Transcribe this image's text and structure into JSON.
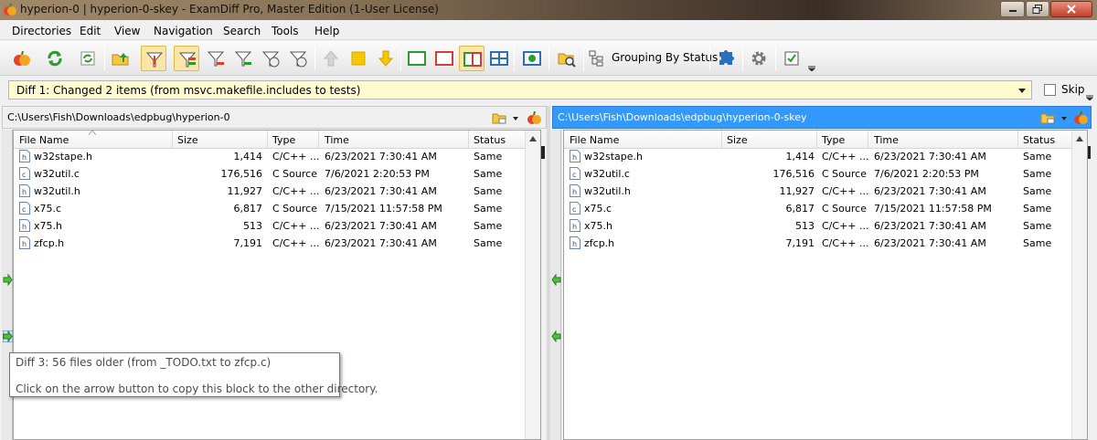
{
  "window": {
    "title": "hyperion-0  |  hyperion-0-skey - ExamDiff Pro, Master Edition (1-User License)"
  },
  "menu": [
    "Directories",
    "Edit",
    "View",
    "Navigation",
    "Search",
    "Tools",
    "Help"
  ],
  "toolbar": {
    "grouping_label": "Grouping By Status"
  },
  "diff_bar": {
    "current_diff": "Diff 1: Changed 2 items (from msvc.makefile.includes to tests)",
    "skip_label": "Skip",
    "skip_checked": false
  },
  "columns": [
    "File Name",
    "Size",
    "Type",
    "Time",
    "Status"
  ],
  "left": {
    "path": "C:\\Users\\Fish\\Downloads\\edpbug\\hyperion-0",
    "rows": [
      {
        "name": "w32stape.h",
        "size": "1,414",
        "type": "C/C++ ...",
        "time": "6/23/2021 7:30:41 AM",
        "status": "Same",
        "icon": "h"
      },
      {
        "name": "w32util.c",
        "size": "176,516",
        "type": "C Source",
        "time": "7/6/2021 2:20:53 PM",
        "status": "Same",
        "icon": "c"
      },
      {
        "name": "w32util.h",
        "size": "11,927",
        "type": "C/C++ ...",
        "time": "6/23/2021 7:30:41 AM",
        "status": "Same",
        "icon": "h"
      },
      {
        "name": "x75.c",
        "size": "6,817",
        "type": "C Source",
        "time": "7/15/2021 11:57:58 PM",
        "status": "Same",
        "icon": "c"
      },
      {
        "name": "x75.h",
        "size": "513",
        "type": "C/C++ ...",
        "time": "6/23/2021 7:30:41 AM",
        "status": "Same",
        "icon": "h"
      },
      {
        "name": "zfcp.h",
        "size": "7,191",
        "type": "C/C++ ...",
        "time": "6/23/2021 7:30:41 AM",
        "status": "Same",
        "icon": "h"
      }
    ]
  },
  "right": {
    "path": "C:\\Users\\Fish\\Downloads\\edpbug\\hyperion-0-skey",
    "rows": [
      {
        "name": "w32stape.h",
        "size": "1,414",
        "type": "C/C++ ...",
        "time": "6/23/2021 7:30:41 AM",
        "status": "Same",
        "icon": "h"
      },
      {
        "name": "w32util.c",
        "size": "176,516",
        "type": "C Source",
        "time": "7/6/2021 2:20:53 PM",
        "status": "Same",
        "icon": "c"
      },
      {
        "name": "w32util.h",
        "size": "11,927",
        "type": "C/C++ ...",
        "time": "6/23/2021 7:30:41 AM",
        "status": "Same",
        "icon": "h"
      },
      {
        "name": "x75.c",
        "size": "6,817",
        "type": "C Source",
        "time": "7/15/2021 11:57:58 PM",
        "status": "Same",
        "icon": "c"
      },
      {
        "name": "x75.h",
        "size": "513",
        "type": "C/C++ ...",
        "time": "6/23/2021 7:30:41 AM",
        "status": "Same",
        "icon": "h"
      },
      {
        "name": "zfcp.h",
        "size": "7,191",
        "type": "C/C++ ...",
        "time": "6/23/2021 7:30:41 AM",
        "status": "Same",
        "icon": "h"
      }
    ]
  },
  "tooltip": {
    "line1": "Diff 3: 56 files older (from _TODO.txt to zfcp.c)",
    "line2": "Click on the arrow button to copy this block to the other directory."
  },
  "colors": {
    "selected_path_bg": "#3399ff",
    "diff_combo_bg": "#fffbcf",
    "active_toolbar_bg": "#fbe6a9"
  }
}
